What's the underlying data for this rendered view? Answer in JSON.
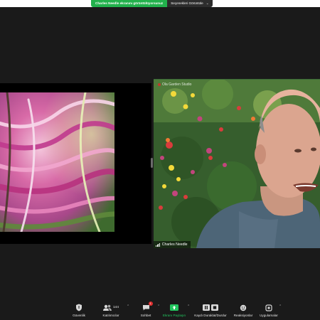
{
  "share_bar": {
    "status_text": "Charles Needle ekranını görüntülüyorsunuz",
    "view_options_label": "Seçenekleri Görüntüle"
  },
  "participant": {
    "name": "Charles Needle",
    "top_label": "Ola Garden Studio"
  },
  "toolbar": {
    "items": [
      {
        "label": "Güvenlik",
        "icon": "shield-icon"
      },
      {
        "label": "Katılımcılar",
        "icon": "participants-icon",
        "count": "144"
      },
      {
        "label": "Sohbet",
        "icon": "chat-icon",
        "badge": "1"
      },
      {
        "label": "Ekranı Paylaşın",
        "icon": "share-screen-icon"
      },
      {
        "label": "Kaydı Duraklat/Durdur",
        "icon": "pause-stop-icon"
      },
      {
        "label": "Reaksiyonlar",
        "icon": "reactions-icon"
      },
      {
        "label": "Uygulamalar",
        "icon": "apps-icon"
      }
    ]
  },
  "colors": {
    "accent_green": "#22b14c",
    "background": "#1a1a1a",
    "badge_red": "#e02f2f"
  }
}
